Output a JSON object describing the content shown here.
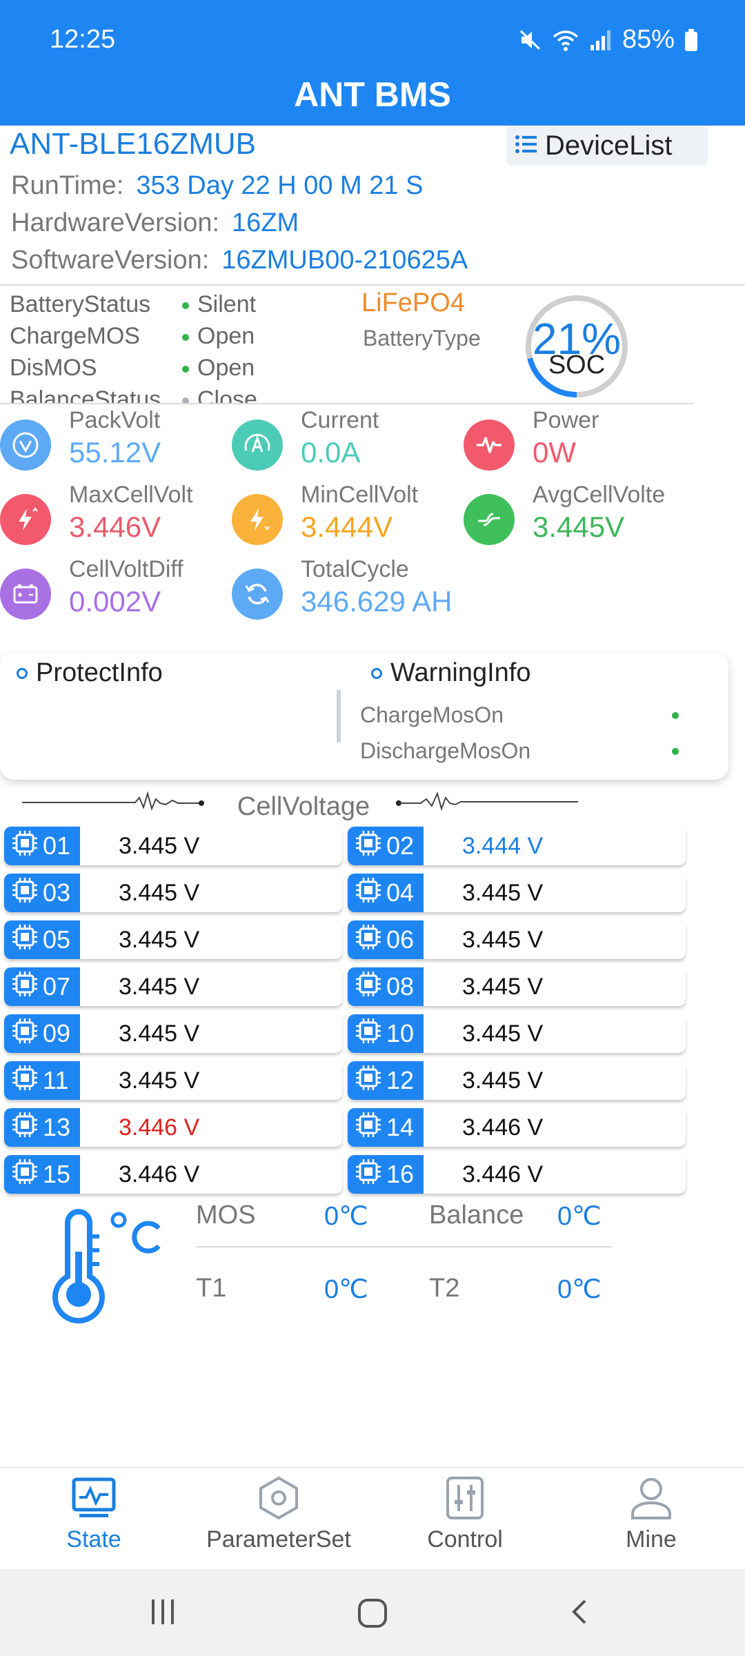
{
  "status_bar": {
    "time": "12:25",
    "battery": "85%",
    "icons": [
      "mute-icon",
      "wifi-icon",
      "signal-icon",
      "battery-icon"
    ]
  },
  "app": {
    "title": "ANT BMS"
  },
  "device": {
    "name": "ANT-BLE16ZMUB",
    "device_list_label": "DeviceList",
    "runtime_label": "RunTime:",
    "runtime_value": "353 Day 22 H 00 M 21 S",
    "hardware_label": "HardwareVersion:",
    "hardware_value": "16ZM",
    "software_label": "SoftwareVersion:",
    "software_value": "16ZMUB00-210625A"
  },
  "battery_status": {
    "rows": [
      {
        "label": "BatteryStatus",
        "value": "Silent"
      },
      {
        "label": "ChargeMOS",
        "value": "Open"
      },
      {
        "label": "DisMOS",
        "value": "Open"
      },
      {
        "label": "BalanceStatus",
        "value": "Close"
      }
    ],
    "battery_type_value": "LiFePO4",
    "battery_type_label": "BatteryType",
    "soc_percent": "21%",
    "soc_label": "SOC",
    "soc_fraction": 0.21
  },
  "metrics": {
    "pack_volt": {
      "label": "PackVolt",
      "value": "55.12V"
    },
    "current": {
      "label": "Current",
      "value": "0.0A"
    },
    "power": {
      "label": "Power",
      "value": "0W"
    },
    "max_cell": {
      "label": "MaxCellVolt",
      "value": "3.446V"
    },
    "min_cell": {
      "label": "MinCellVolt",
      "value": "3.444V"
    },
    "avg_cell": {
      "label": "AvgCellVolte",
      "value": "3.445V"
    },
    "cell_diff": {
      "label": "CellVoltDiff",
      "value": "0.002V"
    },
    "total_cycle": {
      "label": "TotalCycle",
      "value": "346.629 AH"
    }
  },
  "info_card": {
    "protect_title": "ProtectInfo",
    "warning_title": "WarningInfo",
    "warnings": [
      "ChargeMosOn",
      "DischargeMosOn"
    ]
  },
  "cells": {
    "title": "CellVoltage",
    "items": [
      {
        "id": "01",
        "value": "3.445 V",
        "color": "#111111"
      },
      {
        "id": "02",
        "value": "3.444 V",
        "color": "#1a7fe0"
      },
      {
        "id": "03",
        "value": "3.445 V",
        "color": "#111111"
      },
      {
        "id": "04",
        "value": "3.445 V",
        "color": "#111111"
      },
      {
        "id": "05",
        "value": "3.445 V",
        "color": "#111111"
      },
      {
        "id": "06",
        "value": "3.445 V",
        "color": "#111111"
      },
      {
        "id": "07",
        "value": "3.445 V",
        "color": "#111111"
      },
      {
        "id": "08",
        "value": "3.445 V",
        "color": "#111111"
      },
      {
        "id": "09",
        "value": "3.445 V",
        "color": "#111111"
      },
      {
        "id": "10",
        "value": "3.445 V",
        "color": "#111111"
      },
      {
        "id": "11",
        "value": "3.445 V",
        "color": "#111111"
      },
      {
        "id": "12",
        "value": "3.445 V",
        "color": "#111111"
      },
      {
        "id": "13",
        "value": "3.446 V",
        "color": "#e02020"
      },
      {
        "id": "14",
        "value": "3.446 V",
        "color": "#111111"
      },
      {
        "id": "15",
        "value": "3.446 V",
        "color": "#111111"
      },
      {
        "id": "16",
        "value": "3.446 V",
        "color": "#111111"
      }
    ]
  },
  "temperature": {
    "unit_symbol": "°C",
    "mos_label": "MOS",
    "mos_value": "0℃",
    "balance_label": "Balance",
    "balance_value": "0℃",
    "t1_label": "T1",
    "t1_value": "0℃",
    "t2_label": "T2",
    "t2_value": "0℃"
  },
  "tabs": [
    {
      "label": "State",
      "active": true
    },
    {
      "label": "ParameterSet",
      "active": false
    },
    {
      "label": "Control",
      "active": false
    },
    {
      "label": "Mine",
      "active": false
    }
  ],
  "colors": {
    "primary": "#1e86f3",
    "accent_text": "#1a7fe0",
    "ok_green": "#2fb34a",
    "warn_orange": "#ef8a2a",
    "alert_red": "#e02020"
  }
}
